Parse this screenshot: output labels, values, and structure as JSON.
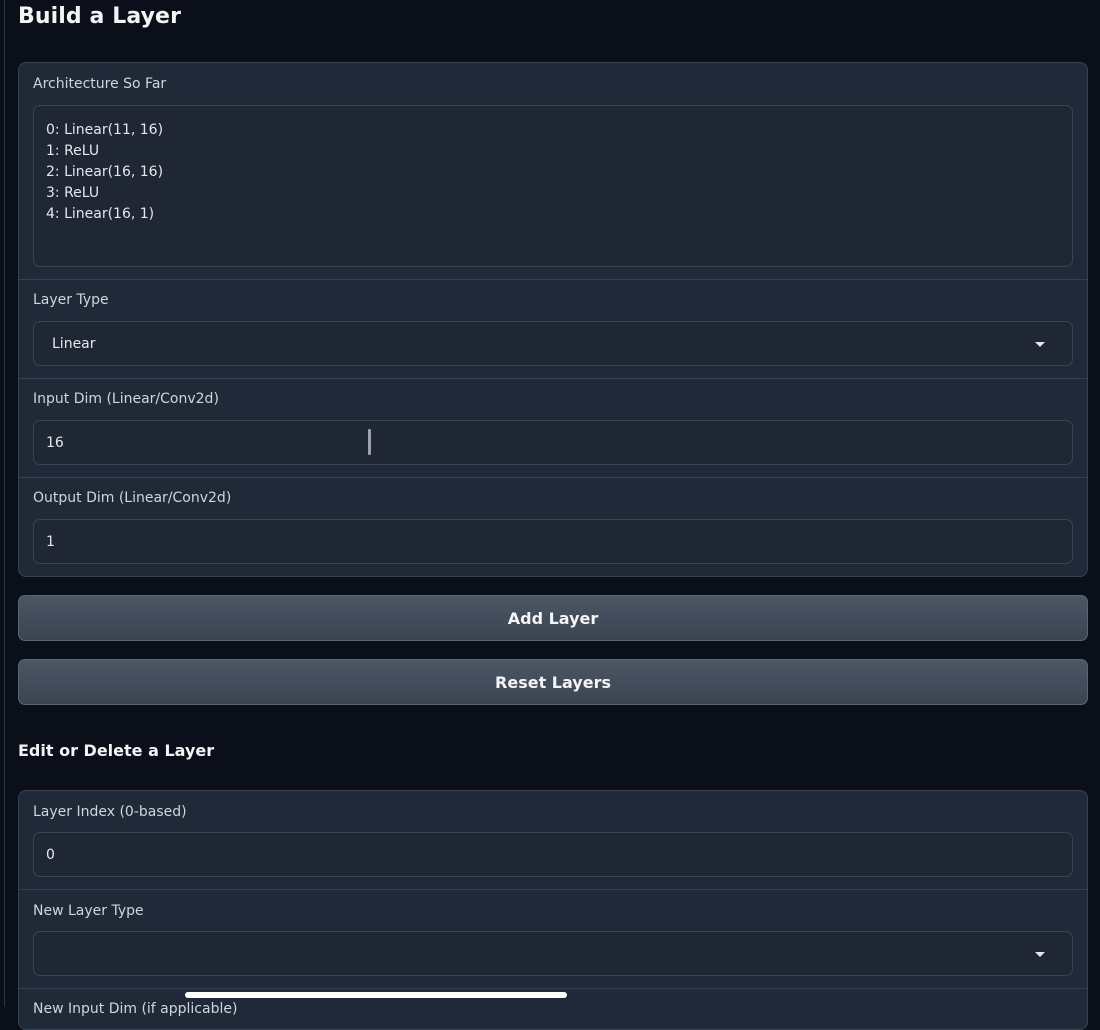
{
  "page": {
    "title": "Build a Layer"
  },
  "build_panel": {
    "architecture": {
      "label": "Architecture So Far",
      "lines": [
        "0: Linear(11, 16)",
        "1: ReLU",
        "2: Linear(16, 16)",
        "3: ReLU",
        "4: Linear(16, 1)"
      ]
    },
    "layer_type": {
      "label": "Layer Type",
      "value": "Linear"
    },
    "input_dim": {
      "label": "Input Dim (Linear/Conv2d)",
      "value": "16"
    },
    "output_dim": {
      "label": "Output Dim (Linear/Conv2d)",
      "value": "1"
    }
  },
  "buttons": {
    "add_label": "Add Layer",
    "reset_label": "Reset Layers"
  },
  "edit_section": {
    "title": "Edit or Delete a Layer",
    "layer_index": {
      "label": "Layer Index (0-based)",
      "value": "0"
    },
    "new_layer_type": {
      "label": "New Layer Type",
      "value": ""
    },
    "next_label_partial": "New Input Dim (if applicable)"
  },
  "colors": {
    "background": "#0b0f19",
    "panel": "#1f2937",
    "border": "#374151",
    "button": "#4b5563",
    "text": "#e5e7eb"
  }
}
